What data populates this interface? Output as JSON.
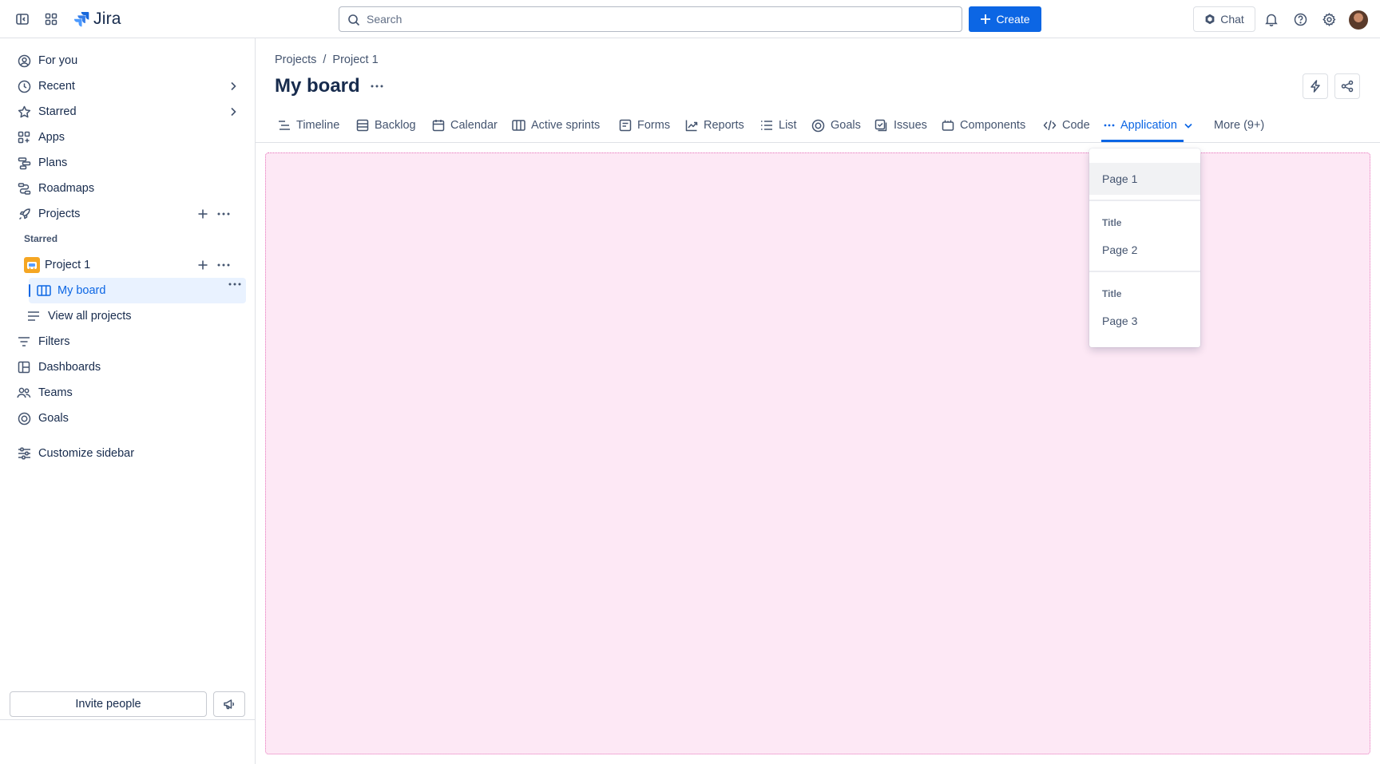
{
  "app": {
    "name": "Jira"
  },
  "search": {
    "placeholder": "Search"
  },
  "topbar": {
    "create_label": "Create",
    "chat_label": "Chat"
  },
  "sidebar": {
    "items": [
      {
        "label": "For you"
      },
      {
        "label": "Recent"
      },
      {
        "label": "Starred"
      },
      {
        "label": "Apps"
      },
      {
        "label": "Plans"
      },
      {
        "label": "Roadmaps"
      },
      {
        "label": "Projects"
      }
    ],
    "starred_section": "Starred",
    "project": {
      "label": "Project 1"
    },
    "board": {
      "label": "My board"
    },
    "view_all": "View all projects",
    "items2": [
      {
        "label": "Filters"
      },
      {
        "label": "Dashboards"
      },
      {
        "label": "Teams"
      },
      {
        "label": "Goals"
      }
    ],
    "customize": "Customize sidebar",
    "invite_label": "Invite people"
  },
  "breadcrumb": {
    "root": "Projects",
    "sep": "/",
    "project": "Project 1"
  },
  "page": {
    "title": "My board"
  },
  "tabs": [
    {
      "label": "Timeline",
      "icon": "timeline-icon"
    },
    {
      "label": "Backlog",
      "icon": "backlog-icon"
    },
    {
      "label": "Calendar",
      "icon": "calendar-icon"
    },
    {
      "label": "Active sprints",
      "icon": "board-icon"
    },
    {
      "label": "Forms",
      "icon": "form-icon"
    },
    {
      "label": "Reports",
      "icon": "chart-icon"
    },
    {
      "label": "List",
      "icon": "list-icon"
    },
    {
      "label": "Goals",
      "icon": "goal-icon"
    },
    {
      "label": "Issues",
      "icon": "issues-icon"
    },
    {
      "label": "Components",
      "icon": "component-icon"
    },
    {
      "label": "Code",
      "icon": "code-icon"
    },
    {
      "label": "Application",
      "icon": "ellipsis-icon",
      "active": true
    },
    {
      "label": "More (9+)"
    }
  ],
  "dropdown": {
    "item1": "Page 1",
    "group2_title": "Title",
    "item2": "Page 2",
    "group3_title": "Title",
    "item3": "Page 3"
  },
  "colors": {
    "accent": "#0c66e4",
    "canvas_bg": "#fde8f5",
    "canvas_border": "#e774bb"
  }
}
